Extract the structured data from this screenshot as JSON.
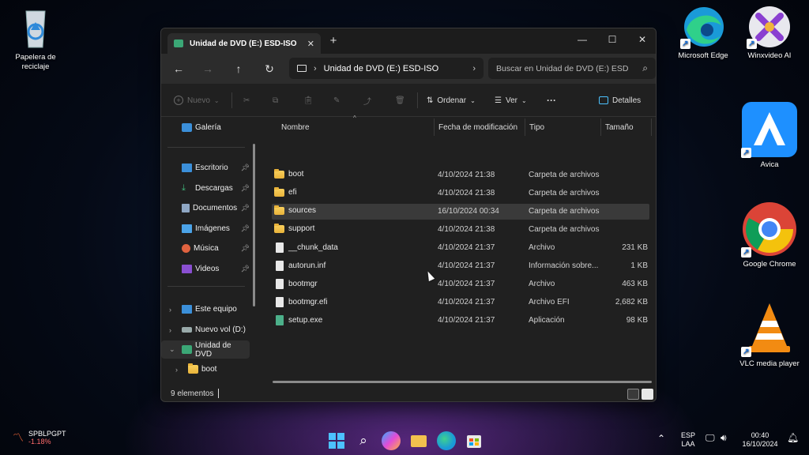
{
  "desktop": {
    "recycle_bin": "Papelera de\nreciclaje",
    "edge": "Microsoft Edge",
    "winxvideo": "Winxvideo AI",
    "avica": "Avica",
    "chrome": "Google Chrome",
    "vlc": "VLC media player"
  },
  "window": {
    "tab_title": "Unidad de DVD (E:) ESD-ISO",
    "address_path": "Unidad de DVD (E:) ESD-ISO",
    "search_placeholder": "Buscar en Unidad de DVD (E:) ESD",
    "toolbar": {
      "new": "Nuevo",
      "sort": "Ordenar",
      "view": "Ver",
      "more": "···",
      "details": "Detalles"
    },
    "sidebar": {
      "gallery": "Galería",
      "pinned": [
        "Escritorio",
        "Descargas",
        "Documentos",
        "Imágenes",
        "Música",
        "Videos"
      ],
      "this_pc": "Este equipo",
      "new_vol": "Nuevo vol (D:)",
      "dvd": "Unidad de DVD",
      "boot": "boot"
    },
    "columns": {
      "name": "Nombre",
      "modified": "Fecha de modificación",
      "type": "Tipo",
      "size": "Tamaño"
    },
    "files": [
      {
        "name": "boot",
        "date": "4/10/2024 21:38",
        "type": "Carpeta de archivos",
        "size": "",
        "kind": "folder"
      },
      {
        "name": "efi",
        "date": "4/10/2024 21:38",
        "type": "Carpeta de archivos",
        "size": "",
        "kind": "folder"
      },
      {
        "name": "sources",
        "date": "16/10/2024 00:34",
        "type": "Carpeta de archivos",
        "size": "",
        "kind": "folder"
      },
      {
        "name": "support",
        "date": "4/10/2024 21:38",
        "type": "Carpeta de archivos",
        "size": "",
        "kind": "folder"
      },
      {
        "name": "__chunk_data",
        "date": "4/10/2024 21:37",
        "type": "Archivo",
        "size": "231 KB",
        "kind": "file"
      },
      {
        "name": "autorun.inf",
        "date": "4/10/2024 21:37",
        "type": "Información sobre...",
        "size": "1 KB",
        "kind": "file"
      },
      {
        "name": "bootmgr",
        "date": "4/10/2024 21:37",
        "type": "Archivo",
        "size": "463 KB",
        "kind": "file"
      },
      {
        "name": "bootmgr.efi",
        "date": "4/10/2024 21:37",
        "type": "Archivo EFI",
        "size": "2,682 KB",
        "kind": "file"
      },
      {
        "name": "setup.exe",
        "date": "4/10/2024 21:37",
        "type": "Aplicación",
        "size": "98 KB",
        "kind": "exe"
      }
    ],
    "status": "9 elementos"
  },
  "taskbar": {
    "ticker": "SPBLPGPT",
    "ticker_change": "-1.18%",
    "lang": "ESP",
    "lang2": "LAA",
    "time": "00:40",
    "date": "16/10/2024"
  },
  "colors": {
    "accent": "#4cc2ff",
    "folder": "#f2c14e",
    "negative": "#ff6b6b"
  }
}
